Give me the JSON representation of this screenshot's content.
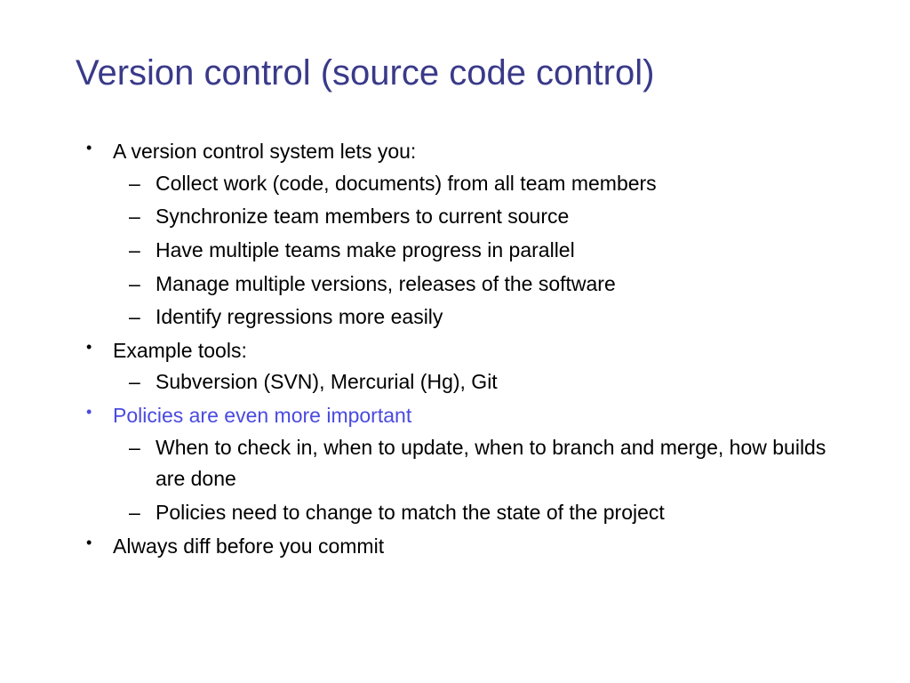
{
  "slide": {
    "title": "Version control (source code control)",
    "bullets": {
      "b1": "A version control system lets you:",
      "b1_1": "Collect work (code, documents) from all team members",
      "b1_2": "Synchronize team members to current source",
      "b1_3": "Have multiple teams make progress in parallel",
      "b1_4": "Manage multiple versions, releases of the software",
      "b1_5": "Identify regressions more easily",
      "b2": "Example tools:",
      "b2_1": "Subversion (SVN), Mercurial (Hg), Git",
      "b3": "Policies are even more important",
      "b3_1": "When to check in, when to update, when to branch and merge, how builds are done",
      "b3_2": "Policies need to change to match the state of the project",
      "b4": "Always diff before you commit"
    }
  }
}
